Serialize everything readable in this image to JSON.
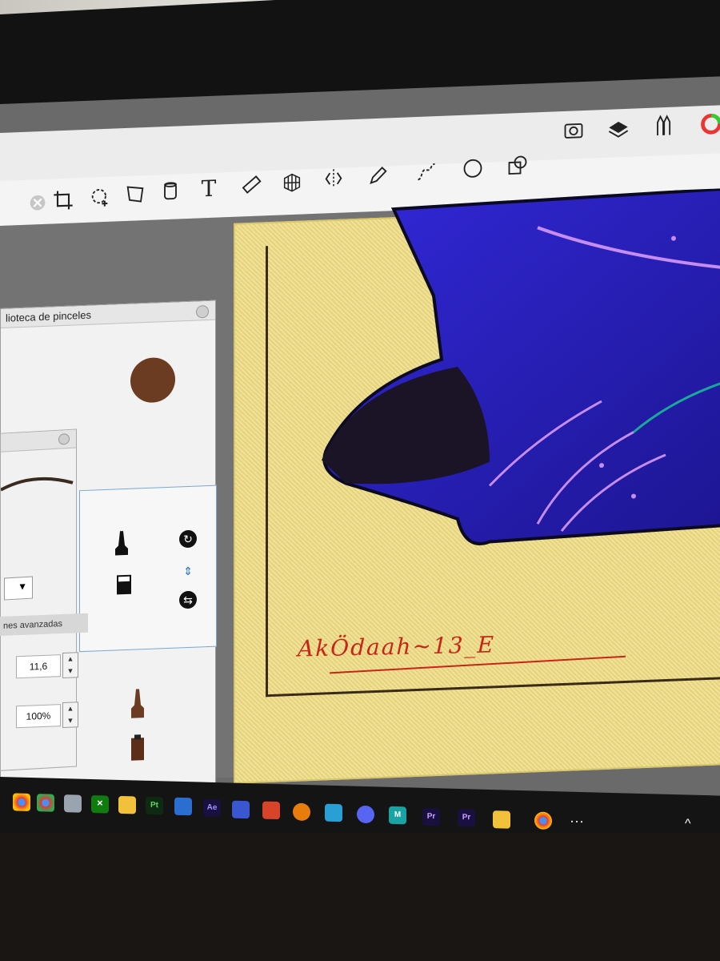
{
  "toolbar": {
    "top_tools": [
      "timelapse-icon",
      "layers-icon",
      "pencils-icon",
      "color-wheel-icon"
    ],
    "main_tools": [
      "crop-icon",
      "selection-add-icon",
      "transform-icon",
      "bucket-icon",
      "text-icon",
      "ruler-icon",
      "perspective-grid-icon",
      "symmetry-icon",
      "pen-icon",
      "curve-icon",
      "ellipse-icon",
      "shapes-icon"
    ]
  },
  "brush_library": {
    "title": "lioteca de pinceles",
    "swatch_color": "#6b3c21",
    "advanced_label": "nes avanzadas",
    "size_value": "11,6",
    "opacity_value": "100%"
  },
  "canvas": {
    "signature": "AkÖdaah~13_E",
    "colors": {
      "paper": "#e9d67f",
      "creature_blue": "#2a24c8",
      "line_red": "#c8241a"
    }
  },
  "taskbar": {
    "apps": [
      {
        "name": "chrome-icon",
        "label": ""
      },
      {
        "name": "chrome-icon-2",
        "label": ""
      },
      {
        "name": "app-icon",
        "label": ""
      },
      {
        "name": "xbox-icon",
        "label": ""
      },
      {
        "name": "folder-icon",
        "label": ""
      },
      {
        "name": "premiere-rush-icon",
        "label": "Pt"
      },
      {
        "name": "photos-icon",
        "label": ""
      },
      {
        "name": "after-effects-icon",
        "label": "Ae"
      },
      {
        "name": "app-icon-2",
        "label": ""
      },
      {
        "name": "app-icon-3",
        "label": ""
      },
      {
        "name": "blender-icon",
        "label": ""
      },
      {
        "name": "app-icon-4",
        "label": ""
      },
      {
        "name": "discord-icon",
        "label": ""
      },
      {
        "name": "app-icon-5",
        "label": "M"
      },
      {
        "name": "premiere-icon",
        "label": "Pr"
      },
      {
        "name": "premiere-icon-2",
        "label": "Pr"
      },
      {
        "name": "app-icon-6",
        "label": ""
      },
      {
        "name": "chrome-icon-3",
        "label": ""
      }
    ],
    "more_label": "···",
    "tray_label": "^"
  }
}
